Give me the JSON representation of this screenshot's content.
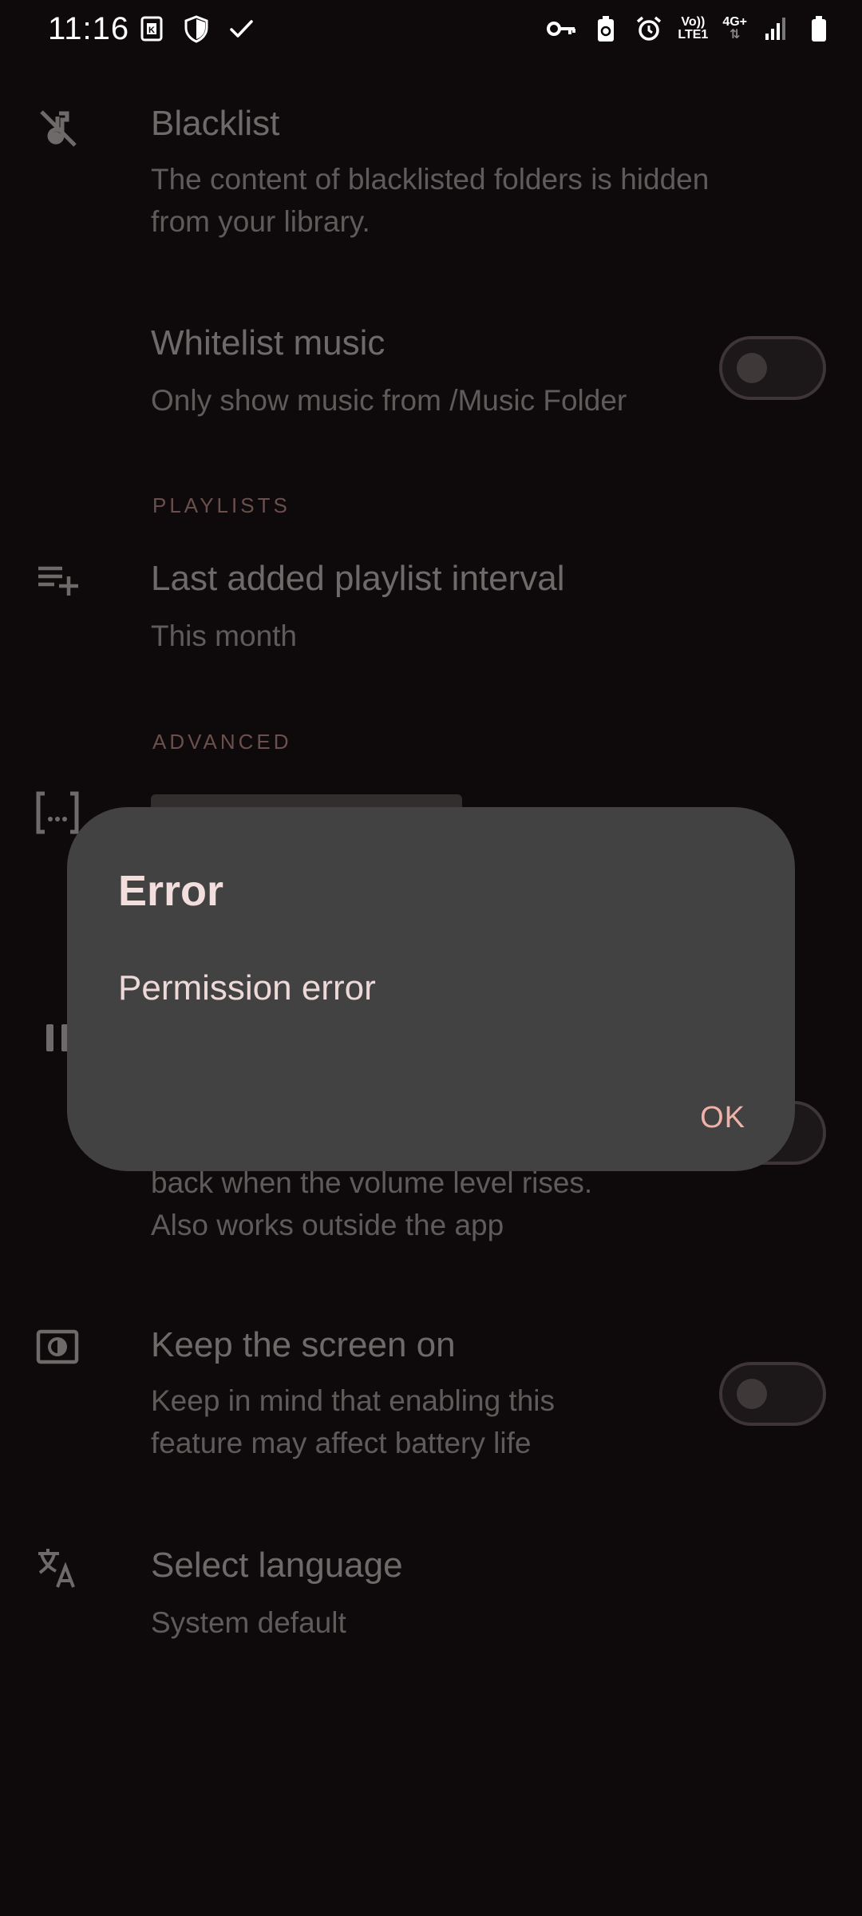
{
  "status_bar": {
    "time": "11:16",
    "network_top": "Vo))",
    "network_bottom": "LTE1",
    "network_gen": "4G+"
  },
  "settings": {
    "blacklist": {
      "title": "Blacklist",
      "subtitle_line1": "The content of blacklisted folders is hidden",
      "subtitle_line2": "from your library.",
      "icon": "music-off-icon"
    },
    "whitelist": {
      "title": "Whitelist music",
      "subtitle": "Only show music from /Music Folder",
      "toggle_on": false
    },
    "playlists_header": "PLAYLISTS",
    "last_added": {
      "title": "Last added playlist interval",
      "subtitle": "This month",
      "icon": "playlist-add-icon"
    },
    "advanced_header": "ADVANCED",
    "filter_icon": "filter-bracket-icon",
    "hidden_row": {
      "subtitle_line1": "back when the volume level rises.",
      "subtitle_line2": "Also works outside the app",
      "toggle_on": false,
      "icon": "pause-icon"
    },
    "keep_screen_on": {
      "title": "Keep the screen on",
      "subtitle_line1": "Keep in mind that enabling this",
      "subtitle_line2": "feature may affect battery life",
      "toggle_on": false,
      "icon": "screen-brightness-icon"
    },
    "language": {
      "title": "Select language",
      "subtitle": "System default",
      "icon": "translate-icon"
    }
  },
  "dialog": {
    "title": "Error",
    "message": "Permission error",
    "ok_label": "OK"
  },
  "colors": {
    "background": "#0e0a0b",
    "dialog_bg": "#424242",
    "accent": "#f2b1a8"
  }
}
